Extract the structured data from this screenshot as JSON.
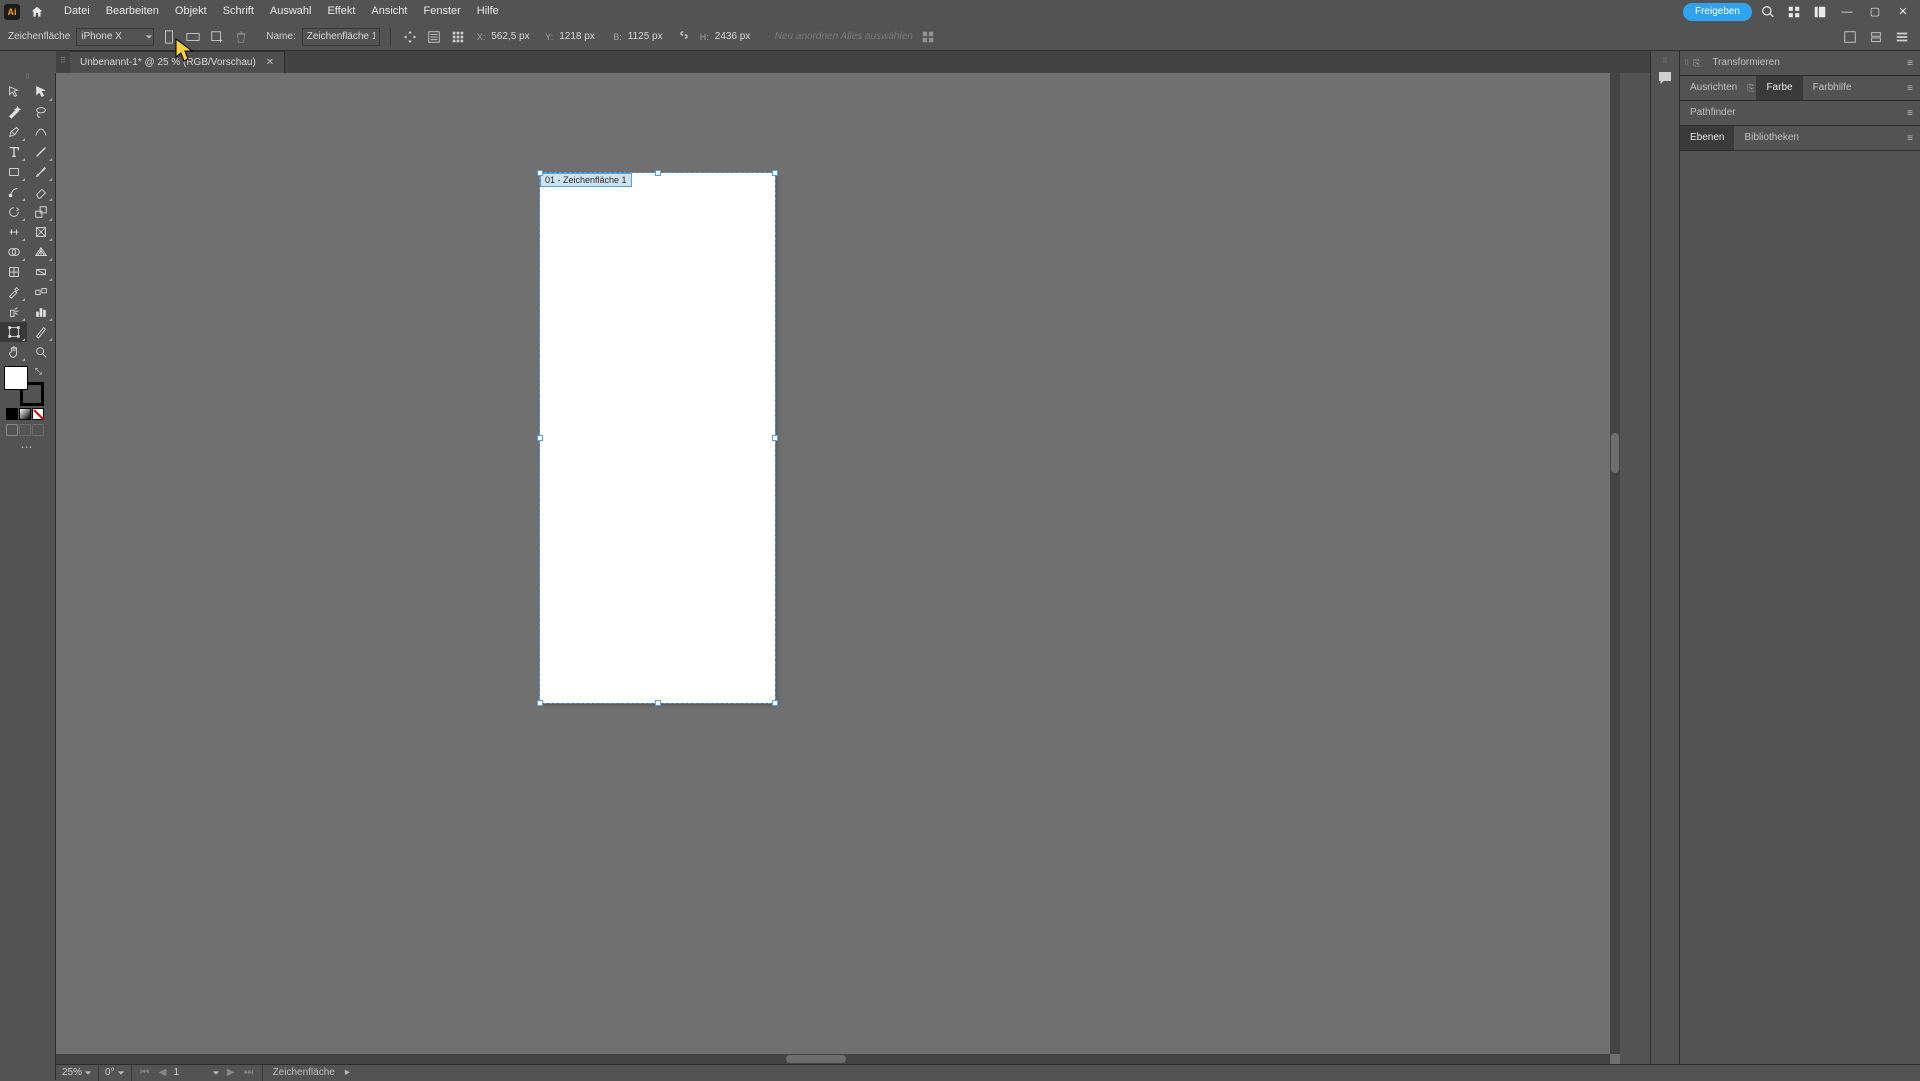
{
  "app": {
    "logo_text": "Ai"
  },
  "menu": {
    "items": [
      "Datei",
      "Bearbeiten",
      "Objekt",
      "Schrift",
      "Auswahl",
      "Effekt",
      "Ansicht",
      "Fenster",
      "Hilfe"
    ],
    "share_label": "Freigeben"
  },
  "control": {
    "mode_label": "Zeichenfläche",
    "preset_value": "iPhone X",
    "name_label": "Name:",
    "name_value": "Zeichenfläche 1",
    "x_label": "X:",
    "x_value": "562,5 px",
    "y_label": "Y:",
    "y_value": "1218 px",
    "w_label": "B:",
    "w_value": "1125 px",
    "h_label": "H:",
    "h_value": "2436 px",
    "rearrange_hint": "Neu anordnen  Alles auswählen"
  },
  "document": {
    "tab_title": "Unbenannt-1* @ 25 % (RGB/Vorschau)",
    "artboard_label": "01 - Zeichenfläche 1"
  },
  "panels": {
    "transform_label": "Transformieren",
    "align_label": "Ausrichten",
    "color_label": "Farbe",
    "colorguide_label": "Farbhilfe",
    "pathfinder_label": "Pathfinder",
    "layers_label": "Ebenen",
    "libraries_label": "Bibliotheken"
  },
  "status": {
    "zoom": "25%",
    "rotation": "0°",
    "artboard_num": "1",
    "tool_label": "Zeichenfläche"
  }
}
